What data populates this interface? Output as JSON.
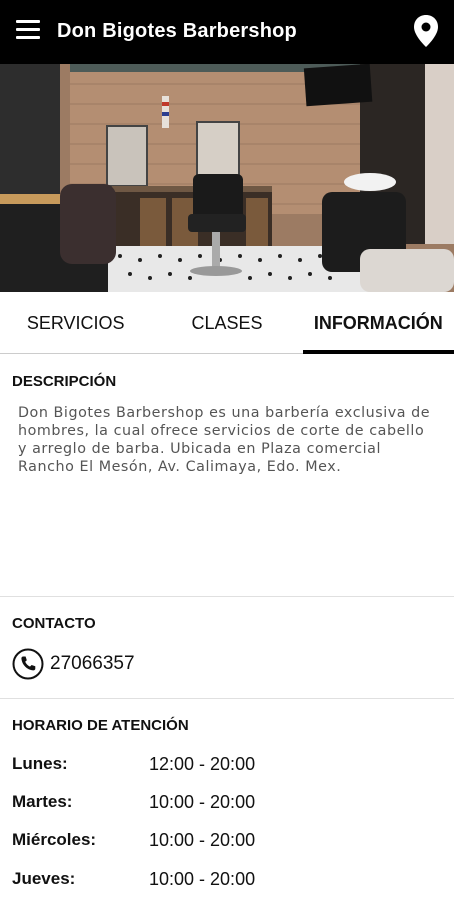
{
  "appbar": {
    "title": "Don Bigotes Barbershop",
    "menu_icon": "hamburger-menu-icon",
    "location_icon": "map-pin-icon"
  },
  "carousel": {
    "total": 2,
    "active_index": 0
  },
  "tabs": [
    {
      "label": "SERVICIOS",
      "active": false
    },
    {
      "label": "CLASES",
      "active": false
    },
    {
      "label": "INFORMACIÓN",
      "active": true
    }
  ],
  "descripcion": {
    "title": "DESCRIPCIÓN",
    "text": "Don Bigotes Barbershop es una barbería exclusiva de hombres, la cual ofrece servicios de corte de cabello y arreglo de barba. Ubicada en Plaza comercial Rancho El Mesón, Av. Calimaya, Edo. Mex."
  },
  "contacto": {
    "title": "CONTACTO",
    "phone": "27066357",
    "phone_icon": "phone-icon"
  },
  "horario": {
    "title": "HORARIO DE ATENCIÓN",
    "days": [
      {
        "day": "Lunes:",
        "hours": "12:00 - 20:00"
      },
      {
        "day": "Martes:",
        "hours": "10:00 - 20:00"
      },
      {
        "day": "Miércoles:",
        "hours": "10:00 - 20:00"
      },
      {
        "day": "Jueves:",
        "hours": "10:00 - 20:00"
      }
    ]
  },
  "colors": {
    "appbar": "#000000",
    "tab_indicator": "#000000",
    "text_muted": "#555555"
  }
}
